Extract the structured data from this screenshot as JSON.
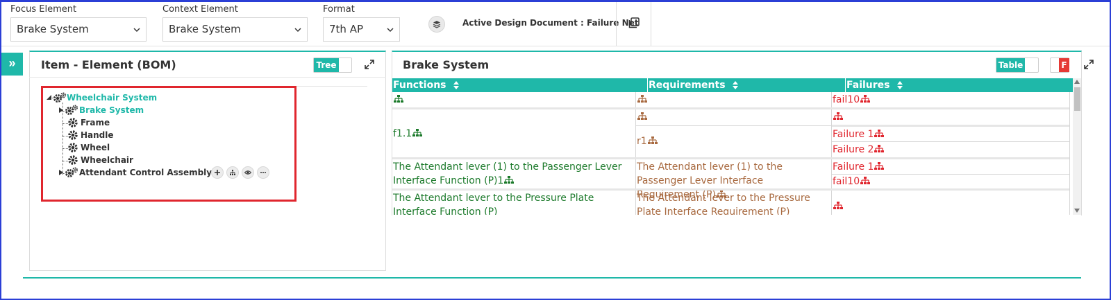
{
  "toolbar": {
    "focus": {
      "label": "Focus Element",
      "value": "Brake System"
    },
    "context": {
      "label": "Context Element",
      "value": "Brake System"
    },
    "format": {
      "label": "Format",
      "value": "7th AP"
    },
    "active_document": "Active Design Document : Failure Net"
  },
  "sidebar": {
    "toggle_label": "»"
  },
  "left_panel": {
    "title": "Item - Element (BOM)",
    "view_toggle": "Tree",
    "tree": [
      {
        "label": "Wheelchair System",
        "level": 0,
        "icon": "gears-icon",
        "expandable": true,
        "highlighted": true
      },
      {
        "label": "Brake System",
        "level": 1,
        "icon": "gears-icon",
        "expandable": true,
        "highlighted": true
      },
      {
        "label": "Frame",
        "level": 1,
        "icon": "gear-icon",
        "expandable": false,
        "highlighted": false
      },
      {
        "label": "Handle",
        "level": 1,
        "icon": "gear-icon",
        "expandable": false,
        "highlighted": false
      },
      {
        "label": "Wheel",
        "level": 1,
        "icon": "gear-icon",
        "expandable": false,
        "highlighted": false
      },
      {
        "label": "Wheelchair",
        "level": 1,
        "icon": "gear-icon",
        "expandable": false,
        "highlighted": false
      },
      {
        "label": "Attendant Control Assembly",
        "level": 1,
        "icon": "gears-icon",
        "expandable": true,
        "highlighted": false
      }
    ],
    "node_actions": [
      "plus-icon",
      "hierarchy-icon",
      "eye-icon",
      "more-icon"
    ]
  },
  "right_panel": {
    "title": "Brake System",
    "view_toggle": "Table",
    "failure_toggle": "F",
    "columns": [
      "Functions",
      "Requirements",
      "Failures"
    ],
    "rows": {
      "r0": {
        "function": "",
        "requirement": "",
        "failure": "fail10"
      },
      "r1": {
        "function": "f1.1",
        "requirement_a": "",
        "requirement_b": "r1",
        "failure_a": "",
        "failure_b": "Failure 1",
        "failure_c": "Failure 2"
      },
      "r2": {
        "function": "The Attendant lever (1) to the Passenger Lever Interface Function (P)1",
        "requirement": "The Attendant lever (1) to the Passenger Lever Interface Requirement (P)",
        "failure_a": "Failure 1",
        "failure_b": "fail10"
      },
      "r3": {
        "function": "The Attendant lever to the Pressure Plate Interface Function (P)",
        "requirement": "The Attendant lever to the Pressure Plate Interface Requirement (P)",
        "failure": ""
      }
    }
  },
  "colors": {
    "accent": "#1fb8a9",
    "function": "#1c7a2b",
    "requirement": "#a8693f",
    "failure": "#e0262e",
    "highlight_box": "#e0262e"
  }
}
